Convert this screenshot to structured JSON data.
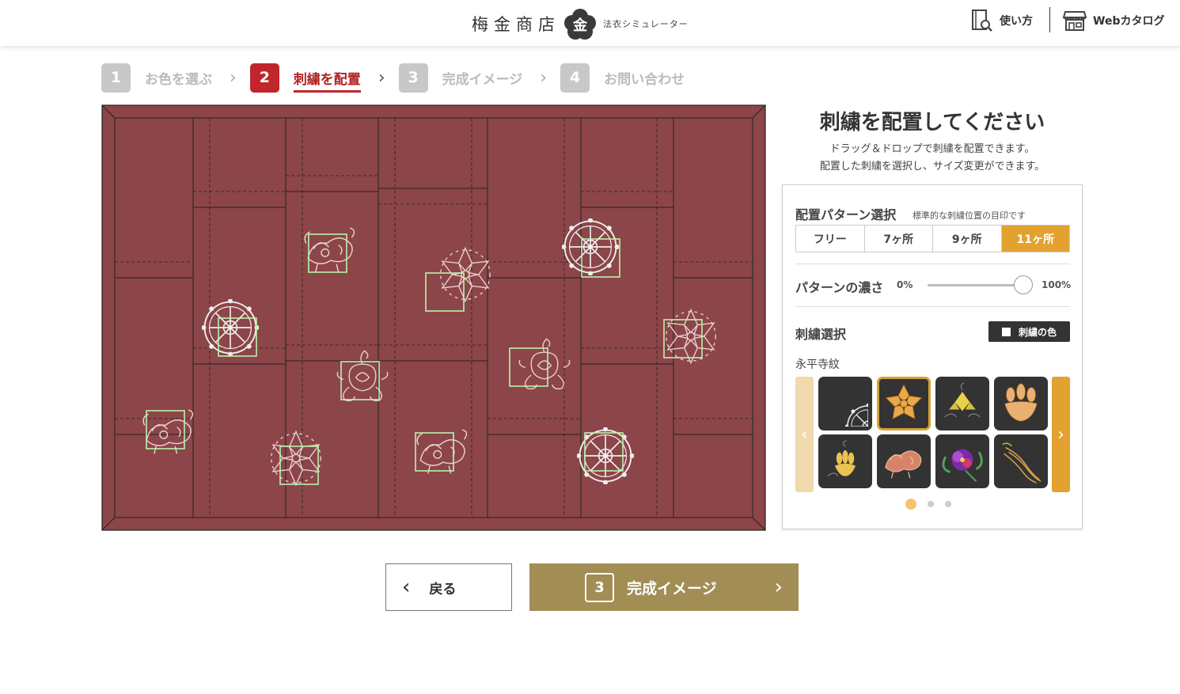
{
  "header": {
    "logo_text": "梅金商店",
    "logo_mark": "金",
    "logo_sub": "法衣シミュレーター",
    "howto_label": "使い方",
    "catalog_label": "Webカタログ"
  },
  "steps": [
    {
      "num": "1",
      "label": "お色を選ぶ",
      "state": "done"
    },
    {
      "num": "2",
      "label": "刺繍を配置",
      "state": "active"
    },
    {
      "num": "3",
      "label": "完成イメージ",
      "state": "todo"
    },
    {
      "num": "4",
      "label": "お問い合わせ",
      "state": "todo"
    }
  ],
  "canvas": {
    "cloth_color": "#8c4548",
    "frame_color": "#8c4548",
    "marker_color": "#b9f2b0"
  },
  "right": {
    "title": "刺繍を配置してください",
    "desc1": "ドラッグ＆ドロップで刺繍を配置できます。",
    "desc2": "配置した刺繍を選択し、サイズ変更ができます。"
  },
  "panel": {
    "pattern_label": "配置パターン選択",
    "pattern_note": "標準的な刺繍位置の目印です",
    "patterns": [
      "フリー",
      "7ヶ所",
      "9ヶ所",
      "11ヶ所"
    ],
    "selected_pattern": "11ヶ所",
    "density_label": "パターンの濃さ",
    "density_min": "0%",
    "density_max": "100%",
    "density_value": 1.0,
    "embroidery_label": "刺繍選択",
    "color_btn_label": "刺繍の色",
    "category": "永平寺紋",
    "accent": "#e3a230"
  },
  "nav": {
    "back_label": "戻る",
    "next_num": "3",
    "next_label": "完成イメージ"
  }
}
